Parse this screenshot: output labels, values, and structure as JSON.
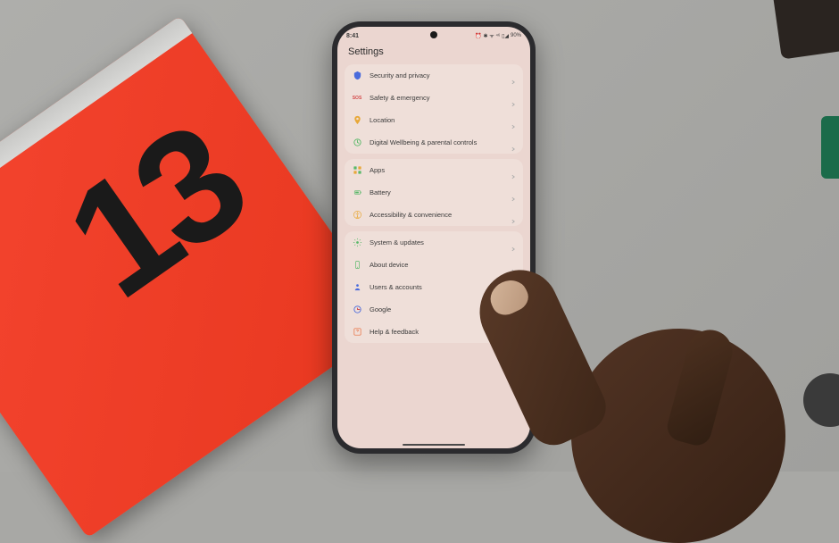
{
  "status_bar": {
    "time": "8:41",
    "battery": "90%",
    "indicators": "⏰ ✱ ᯤ ⁴⁶ ▯◢"
  },
  "page_title": "Settings",
  "groups": [
    {
      "items": [
        {
          "label": "Security and privacy",
          "icon": "shield-icon",
          "color": "#4a6bdc"
        },
        {
          "label": "Safety & emergency",
          "icon": "sos-icon",
          "color": "#d44a4a"
        },
        {
          "label": "Location",
          "icon": "location-icon",
          "color": "#e8a838"
        },
        {
          "label": "Digital Wellbeing & parental controls",
          "icon": "wellbeing-icon",
          "color": "#58b868"
        }
      ]
    },
    {
      "items": [
        {
          "label": "Apps",
          "icon": "apps-icon",
          "color": "#58b868"
        },
        {
          "label": "Battery",
          "icon": "battery-icon",
          "color": "#58b868"
        },
        {
          "label": "Accessibility & convenience",
          "icon": "accessibility-icon",
          "color": "#e8a838"
        }
      ]
    },
    {
      "items": [
        {
          "label": "System & updates",
          "icon": "system-icon",
          "color": "#58b868"
        },
        {
          "label": "About device",
          "icon": "device-icon",
          "color": "#58b868"
        },
        {
          "label": "Users & accounts",
          "icon": "users-icon",
          "color": "#4a6bdc"
        },
        {
          "label": "Google",
          "icon": "google-icon",
          "color": "#4a6bdc"
        },
        {
          "label": "Help & feedback",
          "icon": "help-icon",
          "color": "#e86838"
        }
      ]
    }
  ],
  "box_number": "13"
}
